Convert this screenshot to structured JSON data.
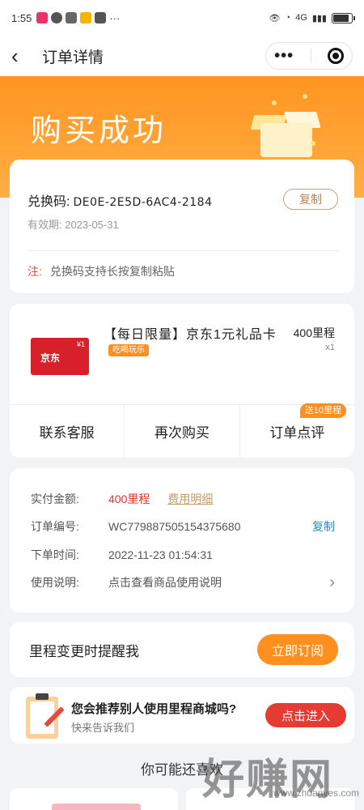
{
  "status_bar": {
    "time": "1:55",
    "network": "4G"
  },
  "nav": {
    "title": "订单详情"
  },
  "hero": {
    "title": "购买成功"
  },
  "code_card": {
    "label": "兑换码:",
    "code": "DE0E-2E5D-6AC4-2184",
    "copy_label": "复制",
    "validity": "有效期: 2023-05-31",
    "note_prefix": "注:",
    "note": "兑换码支持长按复制粘贴"
  },
  "product": {
    "image_brand": "京东",
    "image_value": "¥1",
    "name": "【每日限量】京东1元礼品卡",
    "tag": "吃喝玩乐",
    "price": "400里程",
    "qty": "x1"
  },
  "actions": [
    {
      "label": "联系客服"
    },
    {
      "label": "再次购买"
    },
    {
      "label": "订单点评",
      "badge": "送10里程"
    }
  ],
  "order_info": {
    "paid_label": "实付金额:",
    "paid_value": "400里程",
    "fee_detail": "费用明细",
    "order_no_label": "订单编号:",
    "order_no": "WC779887505154375680",
    "copy_label": "复制",
    "time_label": "下单时间:",
    "time": "2022-11-23 01:54:31",
    "usage_label": "使用说明:",
    "usage": "点击查看商品使用说明"
  },
  "remind": {
    "text": "里程变更时提醒我",
    "button": "立即订阅"
  },
  "recommend": {
    "title": "您会推荐别人使用里程商城吗?",
    "subtitle": "快来告诉我们",
    "button": "点击进入"
  },
  "may_like": "你可能还喜欢",
  "watermark": {
    "big": "好赚网",
    "small": "www.zhuanyes.com"
  },
  "colors": {
    "accent": "#ff8f1f",
    "price_red": "#e0312c",
    "link_blue": "#2c8bd0",
    "enter_red": "#e43b33"
  }
}
